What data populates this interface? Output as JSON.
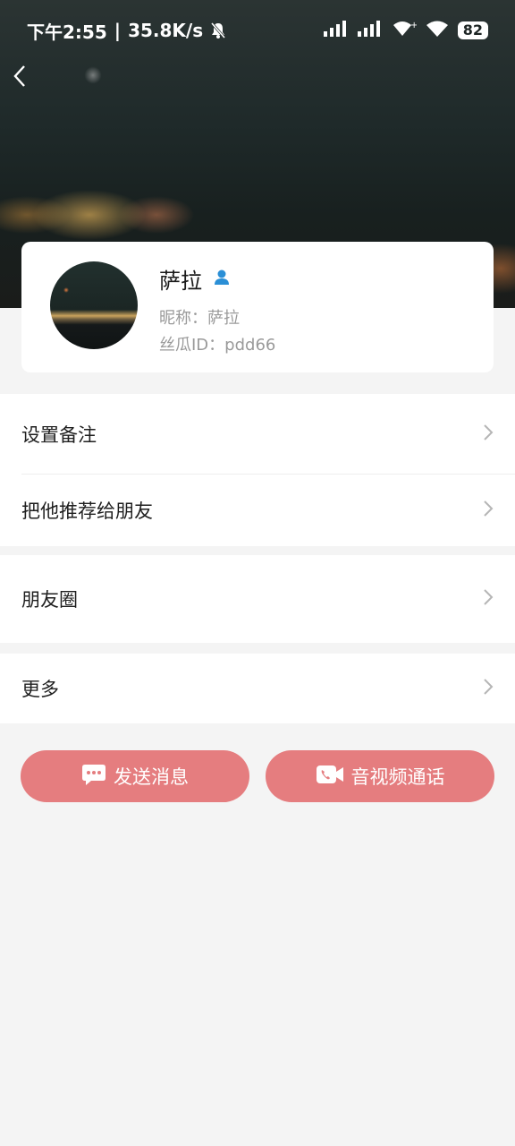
{
  "status_bar": {
    "time": "下午2:55",
    "separator": "|",
    "speed": "35.8K/s",
    "battery": "82"
  },
  "profile": {
    "name": "萨拉",
    "nickname_line": "昵称：萨拉",
    "id_line": "丝瓜ID：pdd66"
  },
  "menu": {
    "set_remark": "设置备注",
    "recommend": "把他推荐给朋友",
    "moments": "朋友圈",
    "more": "更多"
  },
  "actions": {
    "send_message": "发送消息",
    "av_call": "音视频通话"
  },
  "colors": {
    "accent": "#e57d7f",
    "person_icon": "#2b8fd6",
    "bg": "#f4f4f4"
  }
}
